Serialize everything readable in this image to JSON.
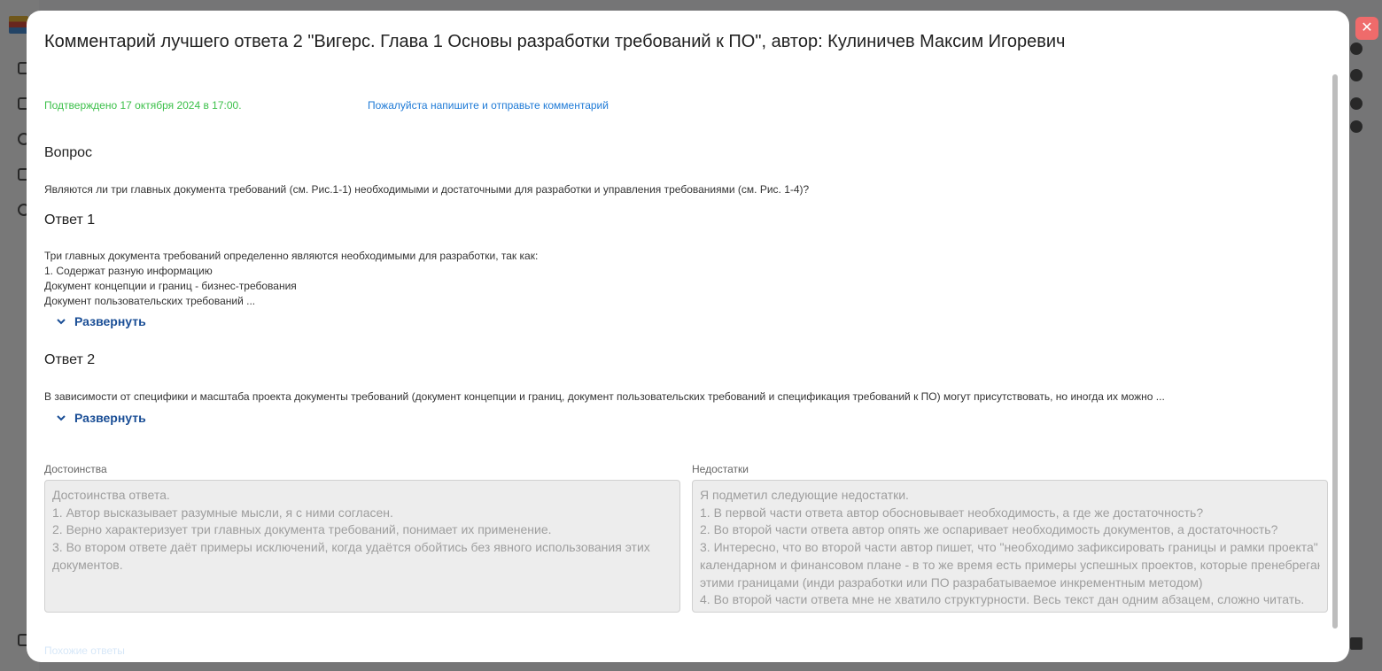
{
  "modal": {
    "title": "Комментарий лучшего ответа 2 \"Вигерс. Глава 1 Основы разработки требований к ПО\", автор: Кулиничев Максим Игоревич",
    "close_glyph": "✕",
    "confirmed_text": "Подтверждено 17 октября 2024 в 17:00.",
    "comment_link": "Пожалуйста напишите и отправьте комментарий"
  },
  "question": {
    "heading": "Вопрос",
    "text": "Являются ли три главных документа требований (см. Рис.1-1) необходимыми и достаточными для разработки и управления требованиями (см. Рис. 1-4)?"
  },
  "answer1": {
    "heading": "Ответ 1",
    "lines": [
      "Три главных документа требований определенно являются необходимыми для разработки, так как:",
      "1. Содержат разную информацию",
      "Документ концепции и границ - бизнес-требования",
      "Документ пользовательских требований ..."
    ],
    "expand_label": "Развернуть"
  },
  "answer2": {
    "heading": "Ответ 2",
    "text": "В зависимости от специфики и масштаба проекта документы требований (документ концепции и границ, документ пользовательских требований и спецификация требований к ПО) могут присутствовать, но иногда их можно ...",
    "expand_label": "Развернуть"
  },
  "advantages": {
    "label": "Достоинства",
    "lines": [
      "Достоинства ответа.",
      "1. Автор высказывает разумные мысли, я с ними согласен.",
      "2. Верно характеризует три главных документа требований, понимает их применение.",
      "3. Во втором ответе даёт примеры исключений, когда удаётся обойтись без явного использования этих",
      "документов."
    ]
  },
  "disadvantages": {
    "label": "Недостатки",
    "lines": [
      "Я подметил следующие недостатки.",
      "1. В первой части ответа автор обосновывает необходимость, а где же достаточность?",
      "2. Во второй части ответа автор опять же оспаривает необходимость документов, а достаточность?",
      "3. Интересно, что во второй части автор пишет, что \"необходимо зафиксировать границы и рамки проекта\" в",
      "календарном и финансовом плане - в то же время есть примеры успешных проектов, которые пренебрегают",
      "этими границами (инди разработки или ПО разрабатываемое инкрементным методом)",
      "4. Во второй части ответа мне не хватило структурности. Весь текст дан одним абзацем, сложно читать."
    ]
  },
  "footer_faded": "Похожие ответы"
}
